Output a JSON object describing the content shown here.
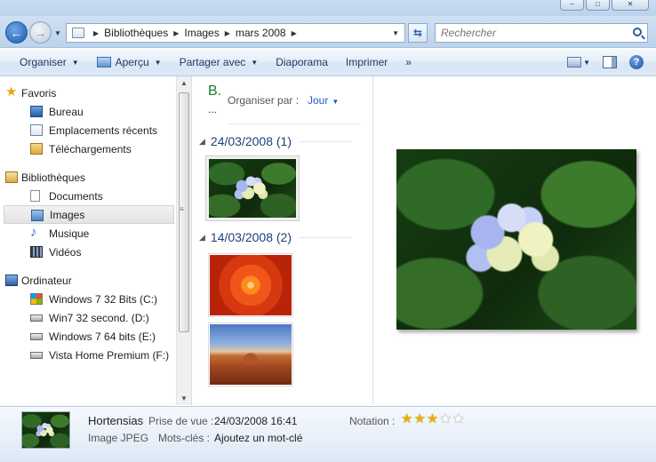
{
  "address": {
    "crumbs": [
      "Bibliothèques",
      "Images",
      "mars 2008"
    ]
  },
  "search": {
    "placeholder": "Rechercher"
  },
  "toolbar": {
    "organize": "Organiser",
    "preview": "Aperçu",
    "share": "Partager avec",
    "slideshow": "Diaporama",
    "print": "Imprimer",
    "more": "»"
  },
  "nav": {
    "favorites": "Favoris",
    "desktop": "Bureau",
    "recent": "Emplacements récents",
    "downloads": "Téléchargements",
    "libraries": "Bibliothèques",
    "documents": "Documents",
    "images": "Images",
    "music": "Musique",
    "videos": "Vidéos",
    "computer": "Ordinateur",
    "drives": [
      "Windows 7 32 Bits (C:)",
      "Win7 32 second. (D:)",
      "Windows 7 64 bits (E:)",
      "Vista Home Premium (F:)"
    ]
  },
  "filelist": {
    "title": "B.",
    "title_more": "...",
    "arrange_label": "Organiser par :",
    "arrange_value": "Jour",
    "groups": [
      {
        "header": "24/03/2008 (1)"
      },
      {
        "header": "14/03/2008 (2)"
      }
    ]
  },
  "details": {
    "name": "Hortensias",
    "type": "Image JPEG",
    "date_label": "Prise de vue :",
    "date_value": "24/03/2008 16:41",
    "tags_label": "Mots-clés :",
    "tags_value": "Ajoutez un mot-clé",
    "rating_label": "Notation :",
    "rating": 3,
    "rating_max": 5
  }
}
